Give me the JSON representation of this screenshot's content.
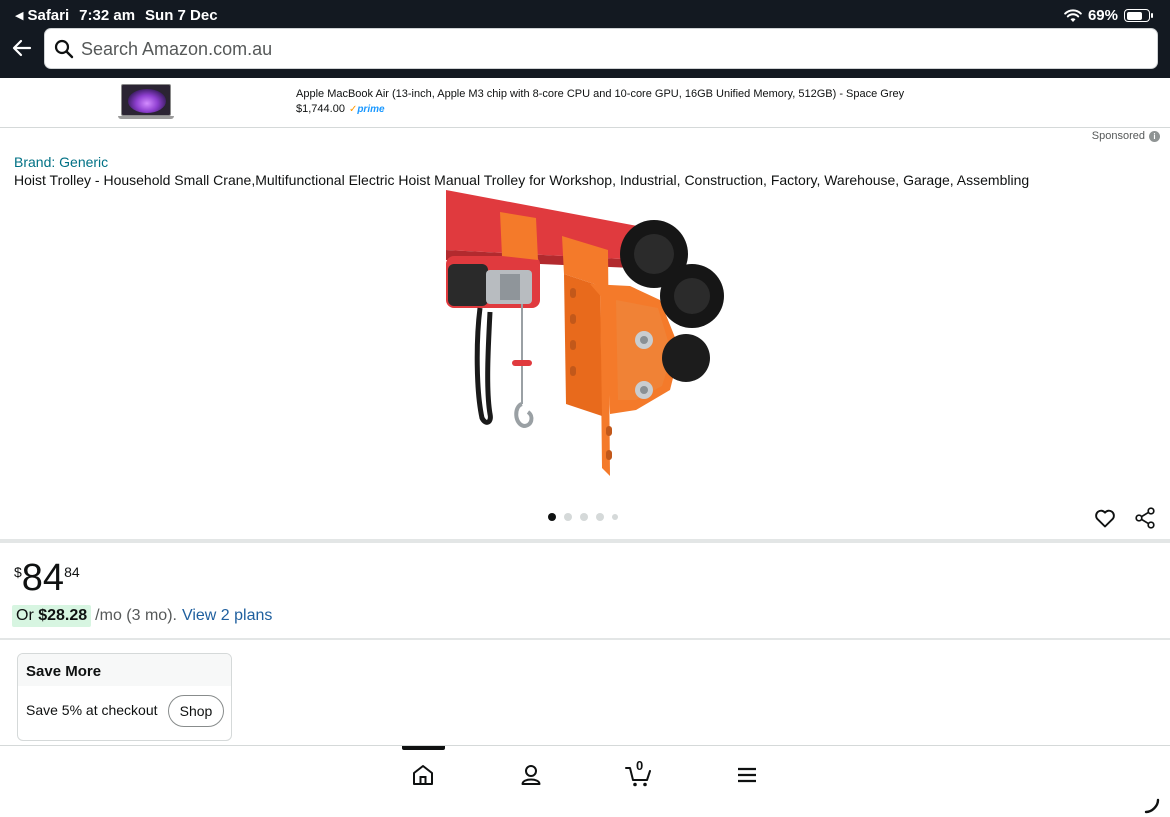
{
  "status_bar": {
    "back_app": "Safari",
    "time": "7:32 am",
    "date": "Sun 7 Dec",
    "battery": "69%",
    "battery_level": 0.69
  },
  "search": {
    "placeholder": "Search Amazon.com.au"
  },
  "ad": {
    "title": "Apple MacBook Air (13-inch, Apple M3 chip with 8-core CPU and 10-core GPU, 16GB Unified Memory, 512GB) - Space Grey",
    "price": "$1,744.00",
    "prime_label": "prime"
  },
  "sponsored_label": "Sponsored",
  "product": {
    "brand": "Brand: Generic",
    "title": "Hoist Trolley - Household Small Crane,Multifunctional Electric Hoist Manual Trolley for Workshop, Industrial, Construction, Factory, Warehouse, Garage, Assembling",
    "image_count": 5,
    "active_image": 1,
    "price_symbol": "$",
    "price_whole": "84",
    "price_fraction": "84",
    "instalment_prefix": "Or",
    "instalment_amount": "$28.28",
    "instalment_suffix": "/mo (3 mo).",
    "view_plans": "View 2 plans"
  },
  "save_more": {
    "heading": "Save More",
    "text": "Save 5% at checkout",
    "button": "Shop"
  },
  "bottom_nav": {
    "cart_count": "0",
    "icons": [
      "home-icon",
      "account-icon",
      "cart-icon",
      "menu-icon"
    ]
  },
  "colors": {
    "header_bg": "#131921",
    "link": "#007185",
    "instalment_highlight": "#d7f5e1",
    "product_orange": "#f47a2a",
    "product_red": "#e03a3e"
  }
}
